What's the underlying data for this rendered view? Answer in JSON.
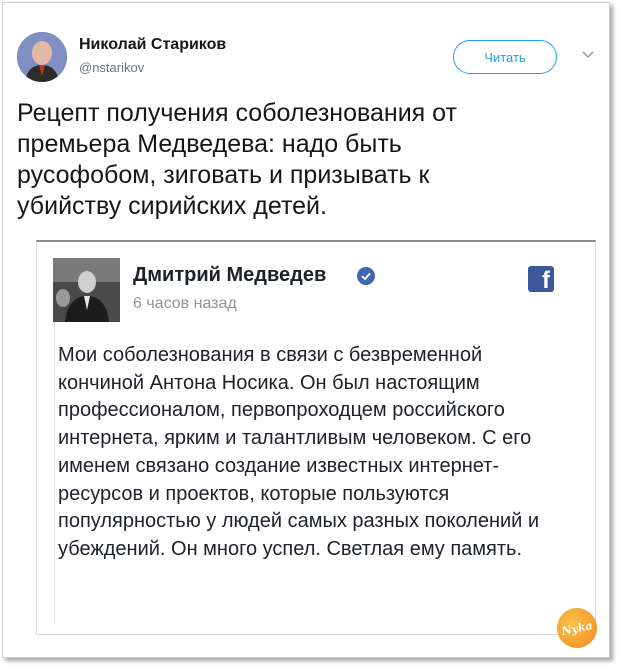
{
  "tweet": {
    "author_name": "Николай Стариков",
    "author_handle": "@nstarikov",
    "follow_label": "Читать",
    "text": "Рецепт получения соболезнования от премьера Медведева: надо быть русофобом, зиговать и призывать к убийству сирийских детей."
  },
  "embedded_post": {
    "author_name": "Дмитрий Медведев",
    "time": "6 часов назад",
    "platform_icon": "facebook-icon",
    "text": "Мои соболезнования в связи с безвременной кончиной Антона Носика. Он был настоящим профессионалом, первопроходцем российского интернета, ярким и талантливым человеком. С его именем связано создание известных интернет-ресурсов и проектов, которые пользуются популярностью у людей самых разных поколений и убеждений. Он много успел. Светлая ему память."
  },
  "watermark": {
    "text": "Nyka"
  },
  "colors": {
    "twitter_blue": "#1da1f2",
    "facebook_blue": "#3b5998",
    "verified_blue": "#4267b2",
    "text_dark": "#14171a",
    "text_muted": "#657786"
  }
}
